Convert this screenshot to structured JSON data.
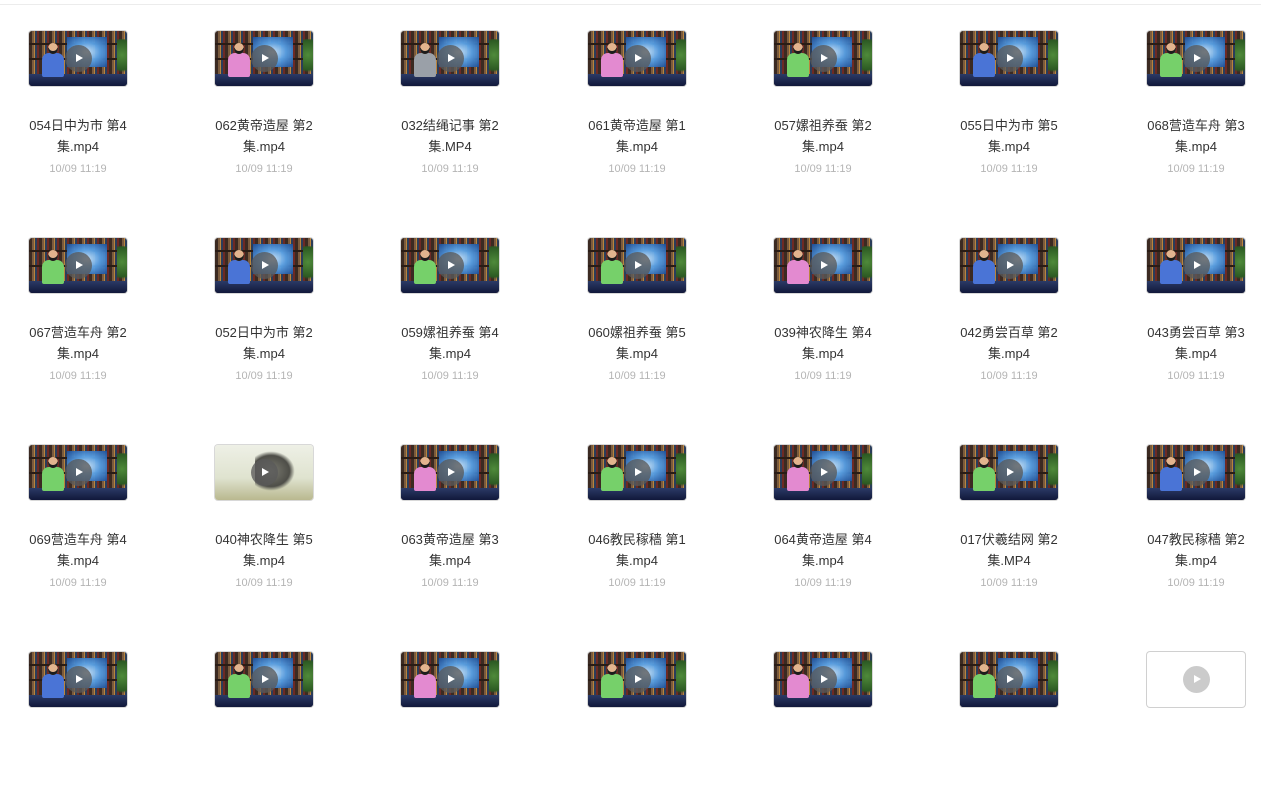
{
  "files": [
    {
      "line1": "054日中为市 第4",
      "line2": "集.mp4",
      "date": "10/09 11:19",
      "shirt": "#4a74d6",
      "thumb": "studio"
    },
    {
      "line1": "062黄帝造屋 第2",
      "line2": "集.mp4",
      "date": "10/09 11:19",
      "shirt": "#e38ad0",
      "thumb": "studio"
    },
    {
      "line1": "032结绳记事 第2",
      "line2": "集.MP4",
      "date": "10/09 11:19",
      "shirt": "#9aa0a8",
      "thumb": "studio"
    },
    {
      "line1": "061黄帝造屋 第1",
      "line2": "集.mp4",
      "date": "10/09 11:19",
      "shirt": "#e38ad0",
      "thumb": "studio"
    },
    {
      "line1": "057嫘祖养蚕 第2",
      "line2": "集.mp4",
      "date": "10/09 11:19",
      "shirt": "#76d06a",
      "thumb": "studio"
    },
    {
      "line1": "055日中为市 第5",
      "line2": "集.mp4",
      "date": "10/09 11:19",
      "shirt": "#4a74d6",
      "thumb": "studio"
    },
    {
      "line1": "068营造车舟 第3",
      "line2": "集.mp4",
      "date": "10/09 11:19",
      "shirt": "#76d06a",
      "thumb": "studio"
    },
    {
      "line1": "067营造车舟 第2",
      "line2": "集.mp4",
      "date": "10/09 11:19",
      "shirt": "#76d06a",
      "thumb": "studio"
    },
    {
      "line1": "052日中为市 第2",
      "line2": "集.mp4",
      "date": "10/09 11:19",
      "shirt": "#4a74d6",
      "thumb": "studio"
    },
    {
      "line1": "059嫘祖养蚕 第4",
      "line2": "集.mp4",
      "date": "10/09 11:19",
      "shirt": "#76d06a",
      "thumb": "studio"
    },
    {
      "line1": "060嫘祖养蚕 第5",
      "line2": "集.mp4",
      "date": "10/09 11:19",
      "shirt": "#76d06a",
      "thumb": "studio"
    },
    {
      "line1": "039神农降生 第4",
      "line2": "集.mp4",
      "date": "10/09 11:19",
      "shirt": "#e38ad0",
      "thumb": "studio"
    },
    {
      "line1": "042勇尝百草 第2",
      "line2": "集.mp4",
      "date": "10/09 11:19",
      "shirt": "#4a74d6",
      "thumb": "studio"
    },
    {
      "line1": "043勇尝百草 第3",
      "line2": "集.mp4",
      "date": "10/09 11:19",
      "shirt": "#4a74d6",
      "thumb": "studio"
    },
    {
      "line1": "069营造车舟 第4",
      "line2": "集.mp4",
      "date": "10/09 11:19",
      "shirt": "#76d06a",
      "thumb": "studio"
    },
    {
      "line1": "040神农降生 第5",
      "line2": "集.mp4",
      "date": "10/09 11:19",
      "shirt": "#cccccc",
      "thumb": "sketch"
    },
    {
      "line1": "063黄帝造屋 第3",
      "line2": "集.mp4",
      "date": "10/09 11:19",
      "shirt": "#e38ad0",
      "thumb": "studio"
    },
    {
      "line1": "046教民稼穑 第1",
      "line2": "集.mp4",
      "date": "10/09 11:19",
      "shirt": "#76d06a",
      "thumb": "studio"
    },
    {
      "line1": "064黄帝造屋 第4",
      "line2": "集.mp4",
      "date": "10/09 11:19",
      "shirt": "#e38ad0",
      "thumb": "studio"
    },
    {
      "line1": "017伏羲结网 第2",
      "line2": "集.MP4",
      "date": "10/09 11:19",
      "shirt": "#76d06a",
      "thumb": "studio"
    },
    {
      "line1": "047教民稼穑 第2",
      "line2": "集.mp4",
      "date": "10/09 11:19",
      "shirt": "#4a74d6",
      "thumb": "studio"
    },
    {
      "line1": "",
      "line2": "",
      "date": "",
      "shirt": "#4a74d6",
      "thumb": "studio"
    },
    {
      "line1": "",
      "line2": "",
      "date": "",
      "shirt": "#76d06a",
      "thumb": "studio"
    },
    {
      "line1": "",
      "line2": "",
      "date": "",
      "shirt": "#e38ad0",
      "thumb": "studio"
    },
    {
      "line1": "",
      "line2": "",
      "date": "",
      "shirt": "#76d06a",
      "thumb": "studio"
    },
    {
      "line1": "",
      "line2": "",
      "date": "",
      "shirt": "#e38ad0",
      "thumb": "studio"
    },
    {
      "line1": "",
      "line2": "",
      "date": "",
      "shirt": "#76d06a",
      "thumb": "studio"
    },
    {
      "line1": "",
      "line2": "",
      "date": "",
      "shirt": "#ffffff",
      "thumb": "blank"
    }
  ],
  "icons": {
    "play": "play-circle-icon"
  }
}
